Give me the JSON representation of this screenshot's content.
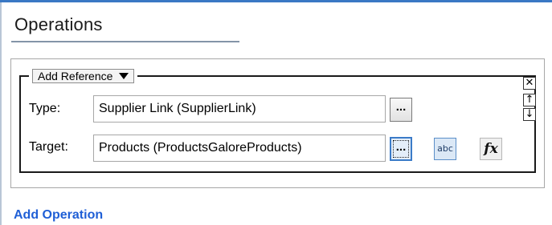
{
  "section": {
    "title": "Operations"
  },
  "reference_group": {
    "dropdown_label": "Add Reference",
    "controls": {
      "close_glyph": "✕",
      "move_up_glyph": "↑",
      "move_down_glyph": "↓"
    }
  },
  "fields": {
    "type": {
      "label": "Type:",
      "value": "Supplier Link (SupplierLink)",
      "browse_label": "..."
    },
    "target": {
      "label": "Target:",
      "value": "Products (ProductsGaloreProducts)",
      "browse_label": "...",
      "text_button_label": "abc",
      "formula_button_label": "fx"
    }
  },
  "footer": {
    "add_operation_label": "Add Operation"
  },
  "colors": {
    "accent_line": "#3a78c4",
    "link": "#1f5fd6",
    "focus_border": "#3b7bc8"
  }
}
